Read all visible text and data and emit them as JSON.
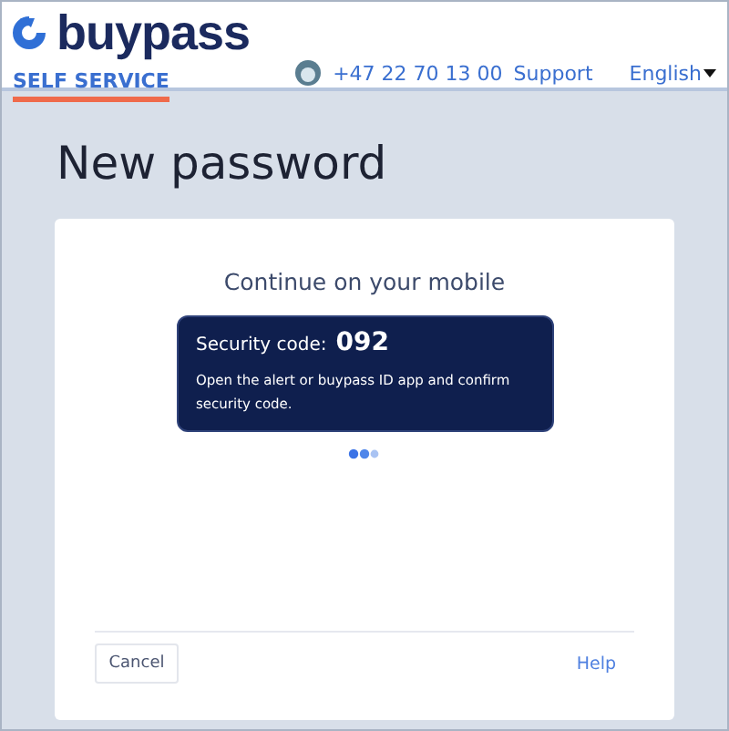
{
  "header": {
    "logo": "buypass",
    "nav": [
      {
        "label": "SELF SERVICE",
        "selected": true
      }
    ],
    "phone": "+47 22 70 13 00",
    "support": "Support",
    "language": "English"
  },
  "page_title": "New password",
  "card": {
    "heading": "Continue on your mobile",
    "code_label": "Security code:",
    "code": "092",
    "instruction": "Open the alert or buypass ID app and confirm security code.",
    "cancel": "Cancel",
    "help": "Help"
  }
}
